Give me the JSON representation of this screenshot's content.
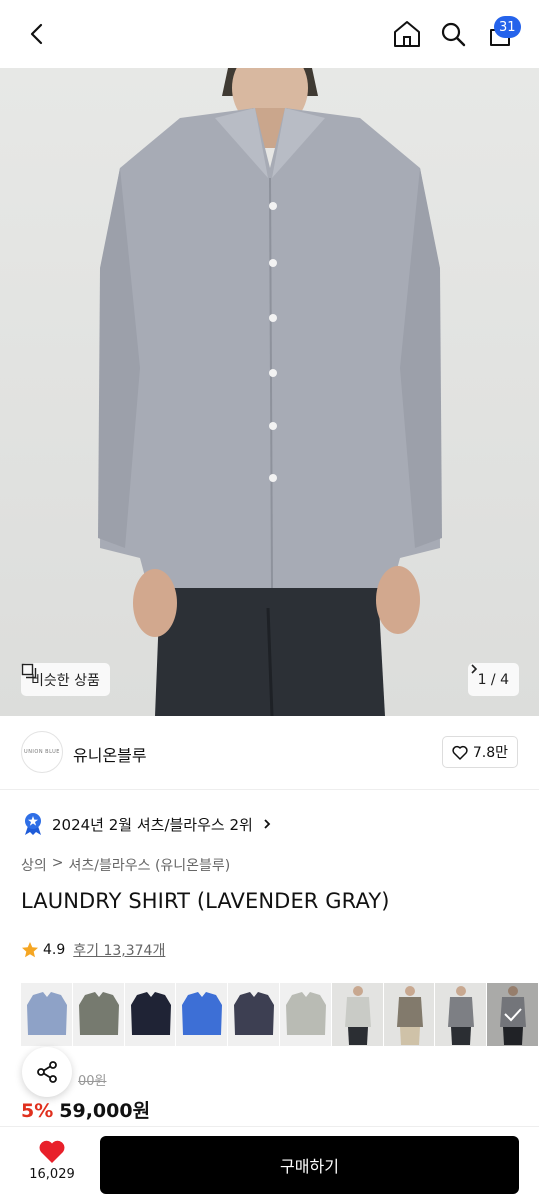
{
  "header": {
    "cart_count": "31"
  },
  "hero": {
    "similar_label": "비슷한 상품",
    "page_indicator": "1 / 4"
  },
  "brand": {
    "logo_text": "UNION BLUE",
    "name": "유니온블루",
    "likes": "7.8만"
  },
  "ranking": {
    "text": "2024년 2월 셔츠/블라우스 2위"
  },
  "breadcrumb": {
    "category": "상의",
    "subcategory": "셔츠/블라우스 (유니온블루)"
  },
  "product": {
    "title": "LAUNDRY SHIRT (LAVENDER GRAY)",
    "rating": "4.9",
    "reviews": "후기 13,374개",
    "old_price": "00원",
    "discount": "5%",
    "price": "59,000원"
  },
  "swatches": {
    "colors": [
      "#8ea2c7",
      "#767a6f",
      "#1f2335",
      "#3d6fd6",
      "#3d3f52",
      "#b9bbb4"
    ]
  },
  "bottom": {
    "heart_count": "16,029",
    "buy_label": "구매하기"
  },
  "colors": {
    "accent_blue": "#2563eb",
    "discount_red": "#e0301e",
    "heart_red": "#e8202a"
  }
}
